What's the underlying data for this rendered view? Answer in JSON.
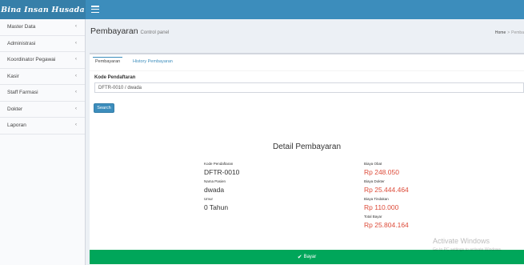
{
  "header": {
    "logo_text": "Bina Insan Husada",
    "menu_icon": "hamburger-icon"
  },
  "sidebar": {
    "items": [
      {
        "label": "Master Data"
      },
      {
        "label": "Administrasi"
      },
      {
        "label": "Koordinator Pegawai"
      },
      {
        "label": "Kasir"
      },
      {
        "label": "Staff Farmasi"
      },
      {
        "label": "Dokter"
      },
      {
        "label": "Laporan"
      }
    ],
    "chevron_glyph": "‹"
  },
  "content_header": {
    "title": "Pembayaran",
    "subtitle": "Control panel",
    "breadcrumb_home": "Home",
    "breadcrumb_sep": ">",
    "breadcrumb_current": "Pemba"
  },
  "tabs": [
    {
      "label": "Pembayaran"
    },
    {
      "label": "History Pembayaran"
    }
  ],
  "form": {
    "kode_label": "Kode Pendaftaran",
    "kode_value": "DFTR-0010 / dwada",
    "search_label": "Search"
  },
  "detail": {
    "title": "Detail Pembayaran",
    "left": [
      {
        "label": "Kode Pendaftaran",
        "value": "DFTR-0010"
      },
      {
        "label": "Nama Pasien",
        "value": "dwada"
      },
      {
        "label": "Umur",
        "value": "0 Tahun"
      }
    ],
    "right": [
      {
        "label": "Biaya Obat",
        "value": "Rp 248.050"
      },
      {
        "label": "Biaya Dokter",
        "value": "Rp 25.444.464"
      },
      {
        "label": "Biaya Tindakan",
        "value": "Rp 110.000"
      },
      {
        "label": "Total Bayar",
        "value": "Rp 25.804.164"
      }
    ],
    "bayar_label": "Bayar",
    "check_glyph": "✔"
  },
  "watermark": {
    "line1": "Activate Windows",
    "line2": "Go to PC settings to activate Windows."
  },
  "colors": {
    "primary": "#3c8dbc",
    "success": "#00a65a",
    "danger": "#dd4b39"
  }
}
